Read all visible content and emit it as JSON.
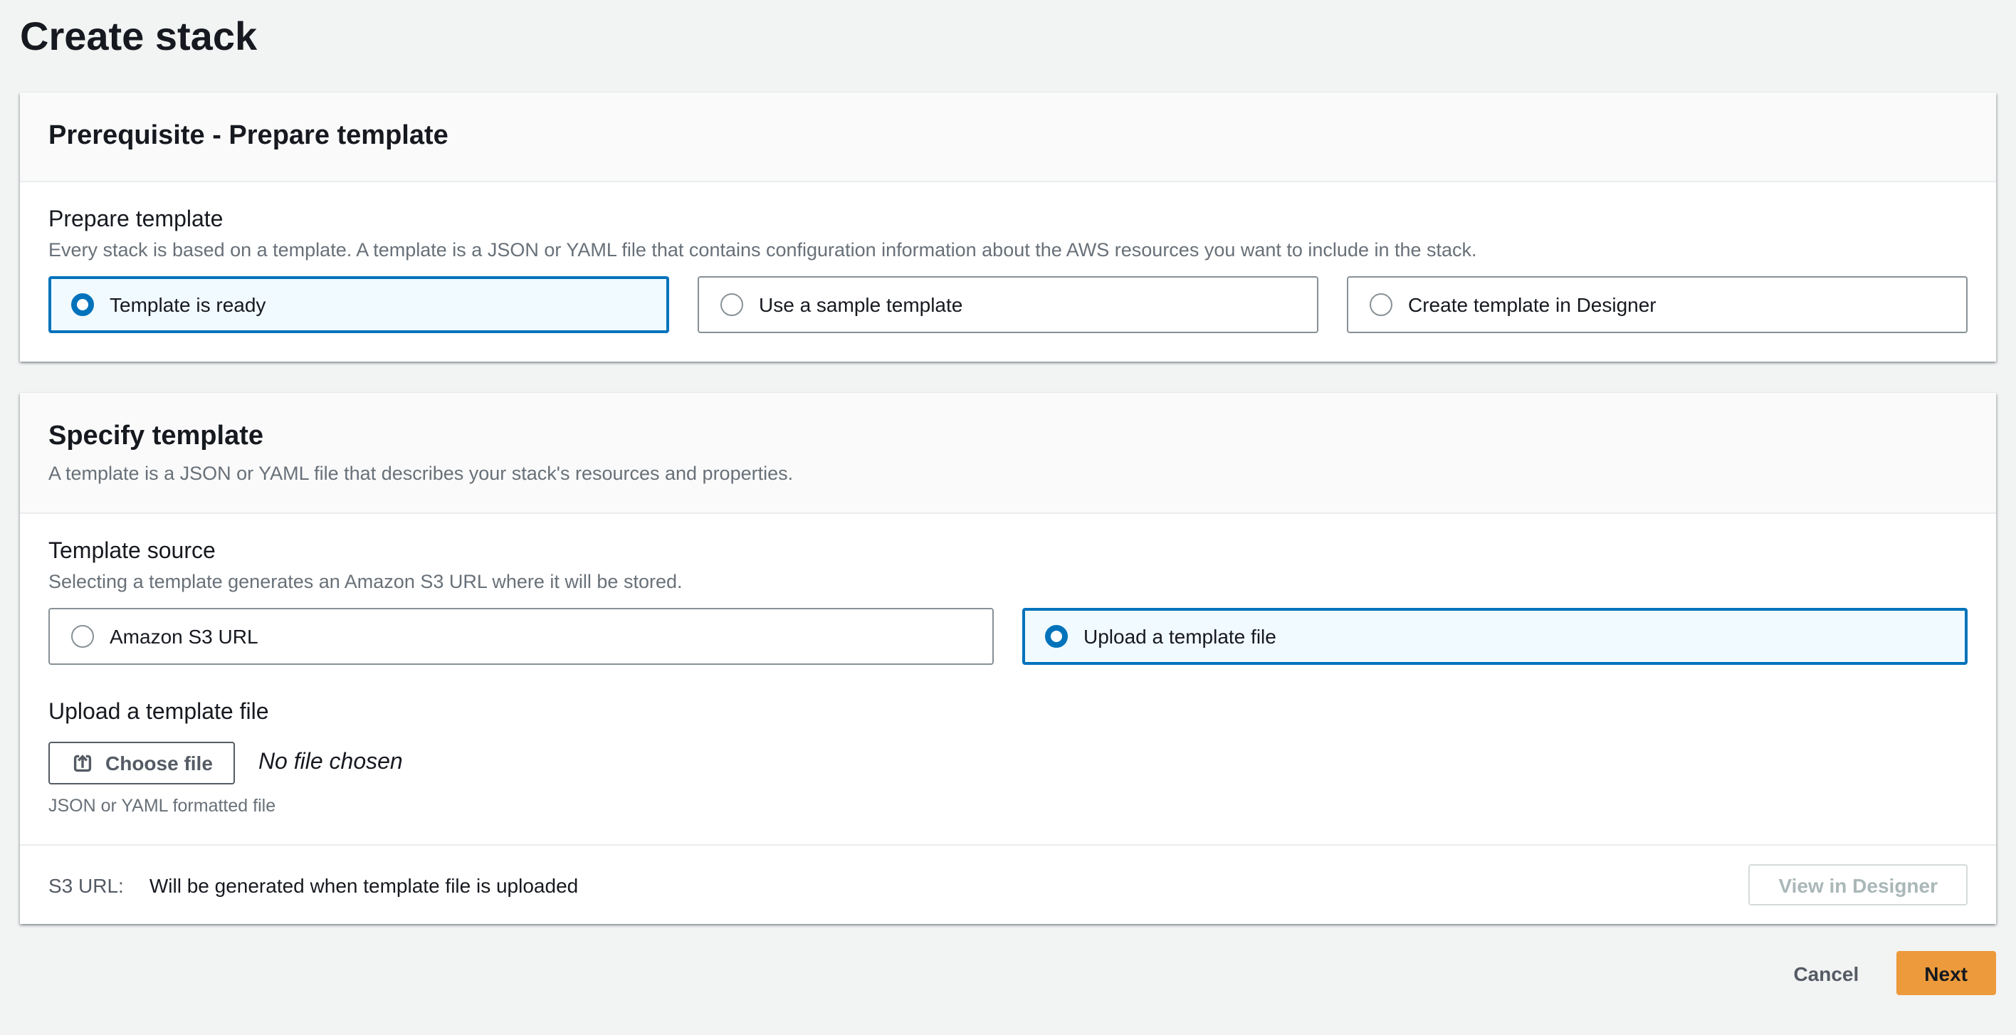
{
  "page": {
    "title": "Create stack"
  },
  "colors": {
    "accent_blue": "#0073bb",
    "selected_tile_bg": "#f1faff",
    "primary_button_bg": "#ec9a3c",
    "page_bg": "#f2f3f3"
  },
  "prerequisite_card": {
    "header": "Prerequisite - Prepare template",
    "field_label": "Prepare template",
    "field_description": "Every stack is based on a template. A template is a JSON or YAML file that contains configuration information about the AWS resources you want to include in the stack.",
    "options": [
      {
        "label": "Template is ready",
        "selected": true
      },
      {
        "label": "Use a sample template",
        "selected": false
      },
      {
        "label": "Create template in Designer",
        "selected": false
      }
    ]
  },
  "specify_card": {
    "header": "Specify template",
    "header_description": "A template is a JSON or YAML file that describes your stack's resources and properties.",
    "source_label": "Template source",
    "source_description": "Selecting a template generates an Amazon S3 URL where it will be stored.",
    "source_options": [
      {
        "label": "Amazon S3 URL",
        "selected": false
      },
      {
        "label": "Upload a template file",
        "selected": true
      }
    ],
    "upload_label": "Upload a template file",
    "choose_file_button": "Choose file",
    "no_file_text": "No file chosen",
    "upload_hint": "JSON or YAML formatted file",
    "s3_url_label": "S3 URL:",
    "s3_url_value": "Will be generated when template file is uploaded",
    "view_in_designer_button": "View in Designer"
  },
  "actions": {
    "cancel": "Cancel",
    "next": "Next"
  }
}
